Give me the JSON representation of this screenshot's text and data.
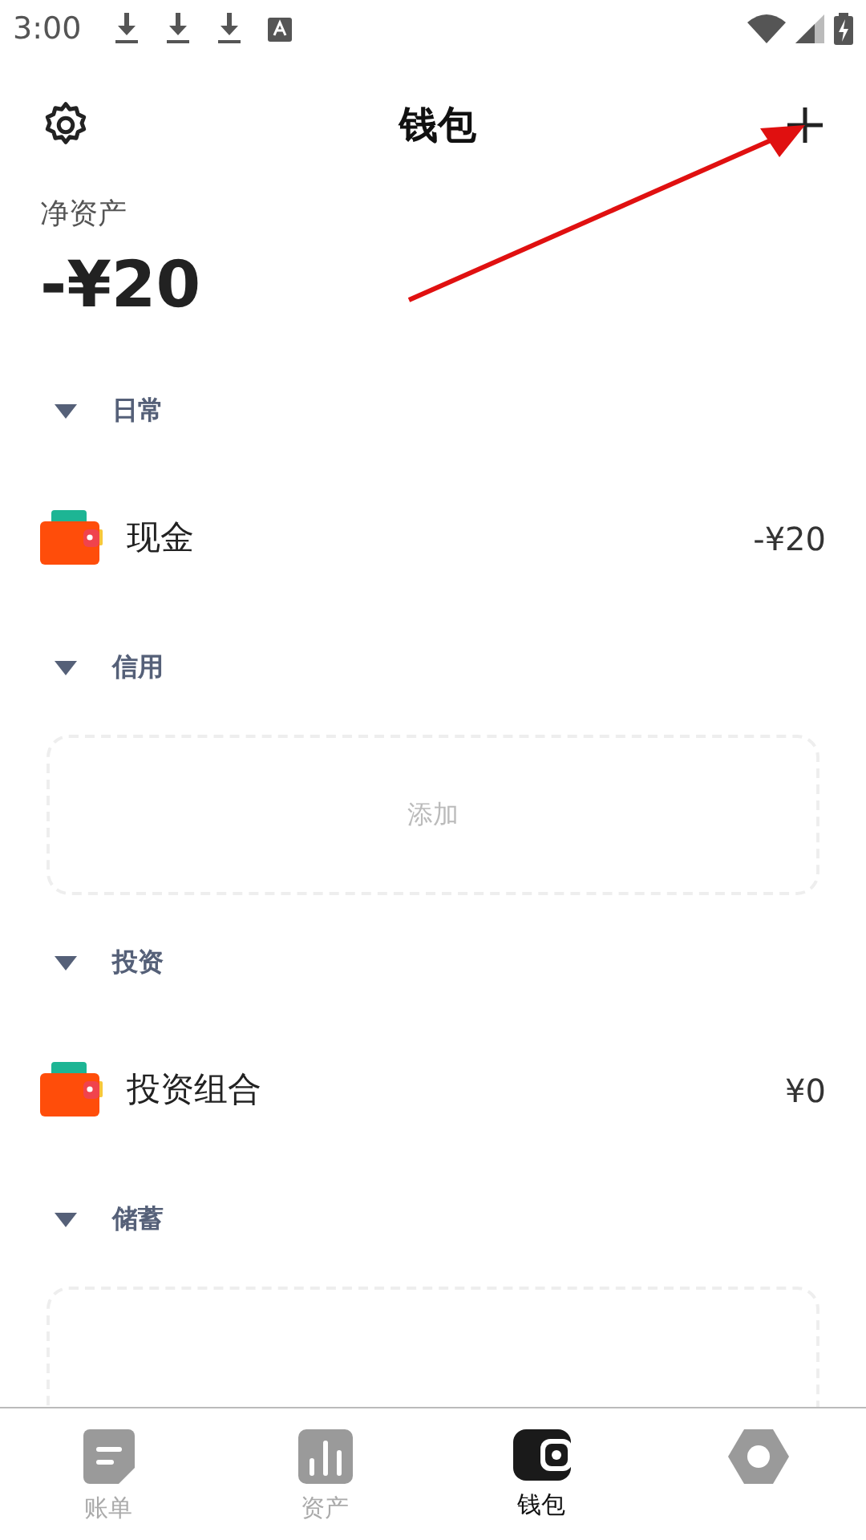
{
  "status_bar": {
    "time": "3:00"
  },
  "header": {
    "title": "钱包"
  },
  "net_worth": {
    "label": "净资产",
    "value": "-¥20"
  },
  "sections": [
    {
      "title": "日常",
      "items": [
        {
          "kind": "account",
          "name": "现金",
          "amount": "-¥20"
        }
      ]
    },
    {
      "title": "信用",
      "items": [
        {
          "kind": "add",
          "label": "添加"
        }
      ]
    },
    {
      "title": "投资",
      "items": [
        {
          "kind": "account",
          "name": "投资组合",
          "amount": "¥0"
        }
      ]
    },
    {
      "title": "储蓄",
      "items": [
        {
          "kind": "add"
        }
      ]
    }
  ],
  "tabs": [
    {
      "label": "账单",
      "selected": false
    },
    {
      "label": "资产",
      "selected": false
    },
    {
      "label": "钱包",
      "selected": true
    },
    {
      "selected": false
    }
  ]
}
